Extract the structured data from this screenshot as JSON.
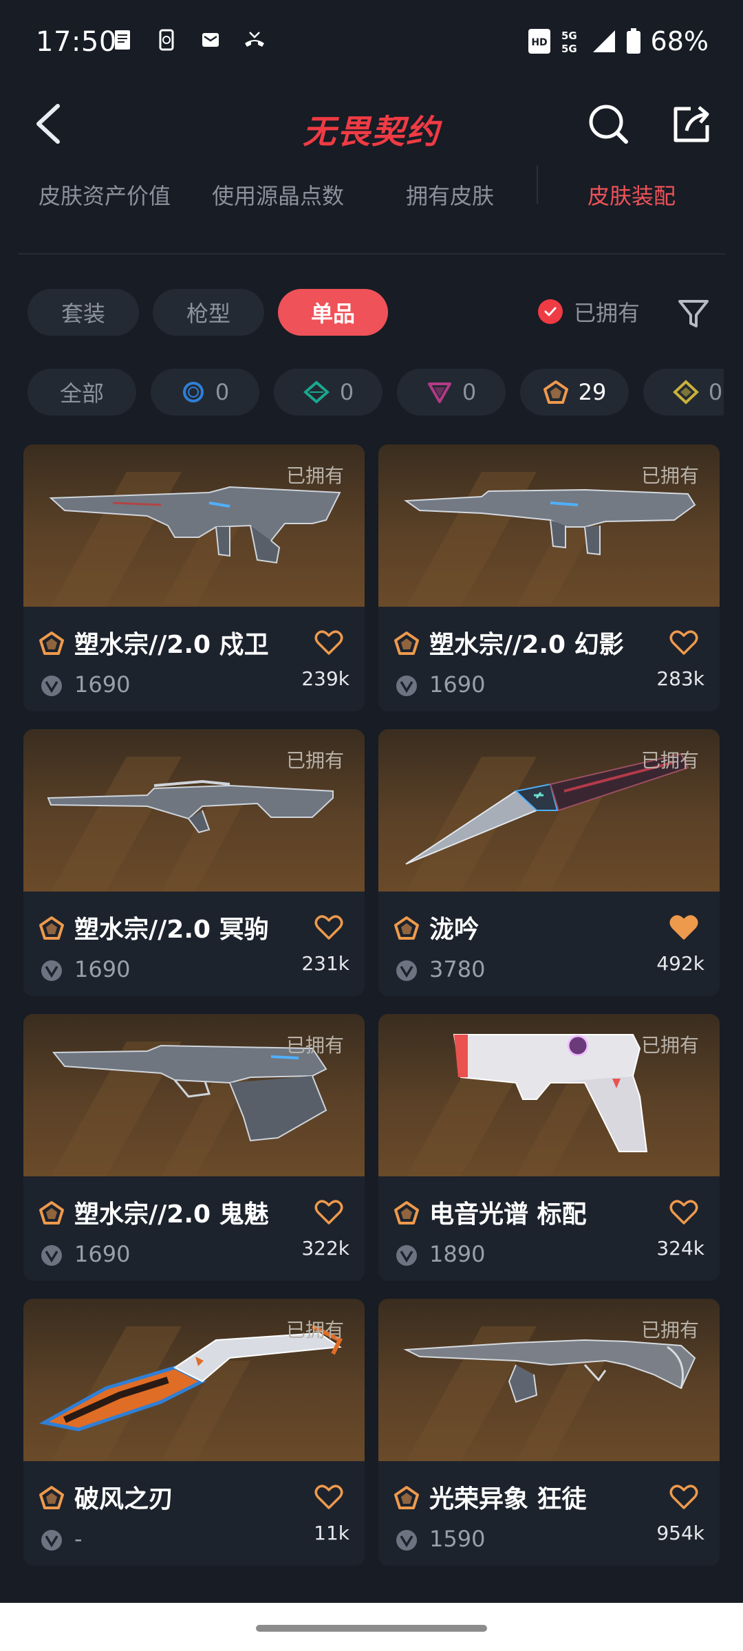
{
  "status_bar": {
    "time": "17:50",
    "network": "5G 5G",
    "battery": "68%"
  },
  "header": {
    "title": "无畏契约"
  },
  "top_tabs": [
    {
      "label": "皮肤资产价值",
      "active": false
    },
    {
      "label": "使用源晶点数",
      "active": false
    },
    {
      "label": "拥有皮肤",
      "active": false
    },
    {
      "label": "皮肤装配",
      "active": true
    }
  ],
  "type_filters": [
    {
      "label": "套装",
      "active": false
    },
    {
      "label": "枪型",
      "active": false
    },
    {
      "label": "单品",
      "active": true
    }
  ],
  "owned_filter": {
    "label": "已拥有",
    "checked": true
  },
  "tier_filters": [
    {
      "label": "全部",
      "icon": "all"
    },
    {
      "count": "0",
      "icon": "select-tier-icon",
      "color": "#2f7fd6"
    },
    {
      "count": "0",
      "icon": "deluxe-tier-icon",
      "color": "#1aa88f"
    },
    {
      "count": "0",
      "icon": "premium-tier-icon",
      "color": "#b43a86"
    },
    {
      "count": "29",
      "icon": "exclusive-tier-icon",
      "color": "#ee9a4d"
    },
    {
      "count": "0",
      "icon": "ultra-tier-icon",
      "color": "#c9b23a"
    }
  ],
  "skins": [
    {
      "name": "塑水宗//2.0 戍卫",
      "price": "1690",
      "likes": "239k",
      "owned": "已拥有",
      "favorited": false
    },
    {
      "name": "塑水宗//2.0 幻影",
      "price": "1690",
      "likes": "283k",
      "owned": "已拥有",
      "favorited": false
    },
    {
      "name": "塑水宗//2.0 冥驹",
      "price": "1690",
      "likes": "231k",
      "owned": "已拥有",
      "favorited": false
    },
    {
      "name": "泷吟",
      "price": "3780",
      "likes": "492k",
      "owned": "已拥有",
      "favorited": true
    },
    {
      "name": "塑水宗//2.0 鬼魅",
      "price": "1690",
      "likes": "322k",
      "owned": "已拥有",
      "favorited": false
    },
    {
      "name": "电音光谱 标配",
      "price": "1890",
      "likes": "324k",
      "owned": "已拥有",
      "favorited": false
    },
    {
      "name": "破风之刃",
      "price": "-",
      "likes": "11k",
      "owned": "已拥有",
      "favorited": false
    },
    {
      "name": "光荣异象 狂徒",
      "price": "1590",
      "likes": "954k",
      "owned": "已拥有",
      "favorited": false
    }
  ],
  "colors": {
    "accent": "#ef5258",
    "tier_exclusive": "#ee9a4d",
    "background": "#171c25"
  }
}
